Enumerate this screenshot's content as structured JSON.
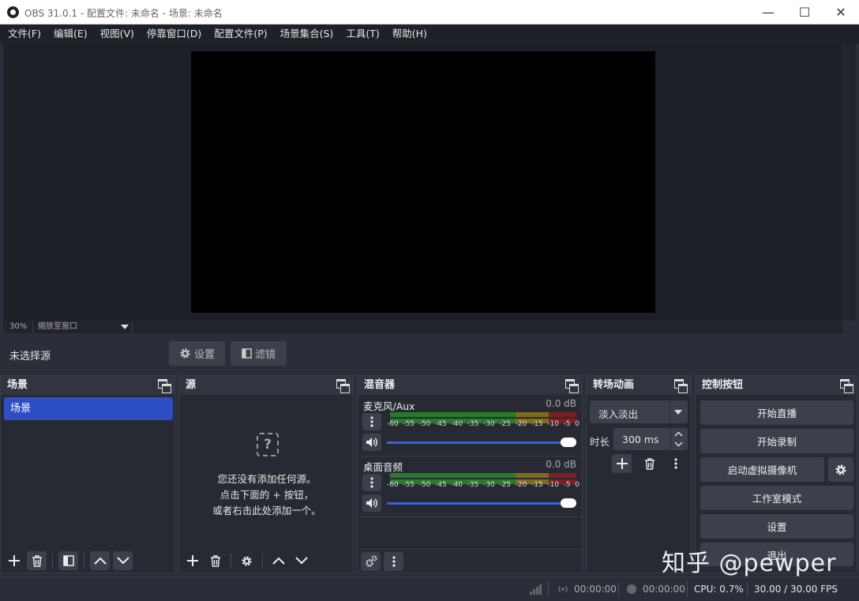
{
  "window": {
    "title": "OBS 31.0.1 - 配置文件: 未命名 - 场景: 未命名"
  },
  "menu": [
    "文件(F)",
    "编辑(E)",
    "视图(V)",
    "停靠窗口(D)",
    "配置文件(P)",
    "场景集合(S)",
    "工具(T)",
    "帮助(H)"
  ],
  "zoom": {
    "value": "30%",
    "mode": "缩放至窗口"
  },
  "source_toolbar": {
    "status": "未选择源",
    "settings_label": "设置",
    "filters_label": "滤镜"
  },
  "scenes": {
    "title": "场景",
    "items": [
      "场景"
    ]
  },
  "sources": {
    "title": "源",
    "empty_lines": [
      "您还没有添加任何源。",
      "点击下面的 + 按钮，",
      "或者右击此处添加一个。"
    ]
  },
  "mixer": {
    "title": "混音器",
    "ticks": [
      "-60",
      "-55",
      "-50",
      "-45",
      "-40",
      "-35",
      "-30",
      "-25",
      "-20",
      "-15",
      "-10",
      "-5",
      "0"
    ],
    "channels": [
      {
        "name": "麦克风/Aux",
        "level": "0.0 dB",
        "volume": 1.0
      },
      {
        "name": "桌面音频",
        "level": "0.0 dB",
        "volume": 1.0
      }
    ]
  },
  "transitions": {
    "title": "转场动画",
    "selected": "淡入淡出",
    "duration_label": "时长",
    "duration": "300 ms"
  },
  "controls": {
    "title": "控制按钮",
    "start_stream": "开始直播",
    "start_record": "开始录制",
    "virtual_cam": "启动虚拟摄像机",
    "studio_mode": "工作室模式",
    "settings": "设置",
    "exit": "退出"
  },
  "status": {
    "stream_time": "00:00:00",
    "record_time": "00:00:00",
    "cpu": "CPU: 0.7%",
    "fps": "30.00 / 30.00 FPS"
  },
  "watermark": "知乎 @pewper"
}
